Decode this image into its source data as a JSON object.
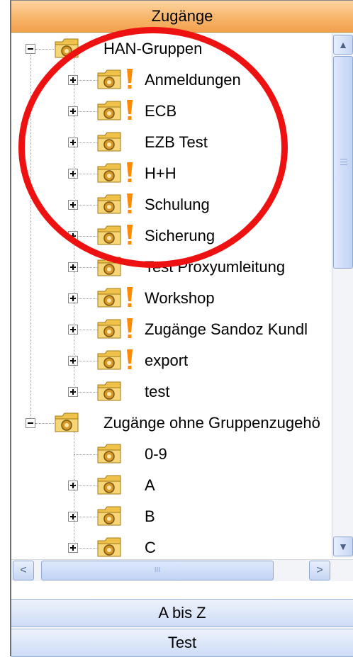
{
  "header": {
    "title": "Zugänge"
  },
  "tree": {
    "groups": [
      {
        "label": "HAN-Gruppen",
        "expanded": true,
        "children": [
          {
            "label": "Anmeldungen",
            "warning": true,
            "expandable": true
          },
          {
            "label": "ECB",
            "warning": true,
            "expandable": true
          },
          {
            "label": "EZB Test",
            "warning": false,
            "expandable": true
          },
          {
            "label": "H+H",
            "warning": true,
            "expandable": true
          },
          {
            "label": "Schulung",
            "warning": true,
            "expandable": true
          },
          {
            "label": "Sicherung",
            "warning": true,
            "expandable": true
          },
          {
            "label": "Test Proxyumleitung",
            "warning": false,
            "expandable": true
          },
          {
            "label": "Workshop",
            "warning": true,
            "expandable": true
          },
          {
            "label": "Zugänge Sandoz Kundl",
            "warning": true,
            "expandable": true
          },
          {
            "label": "export",
            "warning": true,
            "expandable": true
          },
          {
            "label": "test",
            "warning": false,
            "expandable": true
          }
        ]
      },
      {
        "label": "Zugänge ohne Gruppenzugehö",
        "expanded": true,
        "children": [
          {
            "label": "0-9",
            "warning": false,
            "expandable": false
          },
          {
            "label": "A",
            "warning": false,
            "expandable": true
          },
          {
            "label": "B",
            "warning": false,
            "expandable": true
          },
          {
            "label": "C",
            "warning": false,
            "expandable": true
          }
        ]
      }
    ]
  },
  "scrollbar": {
    "grip_label": "III"
  },
  "nav": {
    "a_bis_z": "A bis Z",
    "test": "Test"
  },
  "colors": {
    "header": "#f7b56a",
    "warning": "#ff8a00",
    "highlight_circle": "#ee1111",
    "folder": "#f0c24a"
  }
}
